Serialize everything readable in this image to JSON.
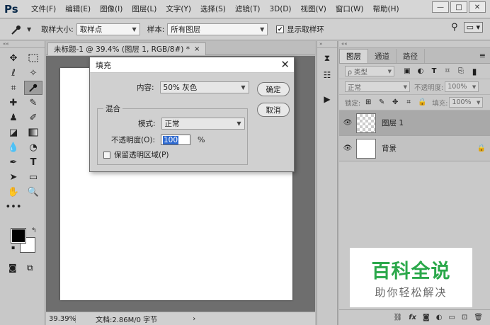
{
  "app": {
    "logo": "Ps",
    "menu": [
      "文件(F)",
      "编辑(E)",
      "图像(I)",
      "图层(L)",
      "文字(Y)",
      "选择(S)",
      "滤镜(T)",
      "3D(D)",
      "视图(V)",
      "窗口(W)",
      "帮助(H)"
    ],
    "window_controls": {
      "minimize": "—",
      "maximize": "□",
      "close": "✕"
    }
  },
  "options": {
    "sample_size_label": "取样大小:",
    "sample_size_value": "取样点",
    "sample_label": "样本:",
    "sample_value": "所有图层",
    "ring_checked": "✔",
    "ring_label": "显示取样环"
  },
  "document": {
    "tab_title": "未标题-1 @ 39.4% (图层 1, RGB/8#) *",
    "tab_close": "×",
    "zoom": "39.39%",
    "doc_info": "文档:2.86M/0 字节",
    "status_arrow": "›"
  },
  "layers_panel": {
    "tabs": [
      "图层",
      "通道",
      "路径"
    ],
    "filter_label": "ρ 类型",
    "blend_mode": "正常",
    "opacity_label": "不透明度:",
    "opacity_value": "100%",
    "lock_label": "锁定:",
    "fill_label": "填充:",
    "fill_value": "100%",
    "layers": [
      {
        "name": "图层 1"
      },
      {
        "name": "背景",
        "lock": "🔒"
      }
    ],
    "footer_fx": "fx"
  },
  "dialog": {
    "title": "填充",
    "close": "✕",
    "contents_label": "内容:",
    "contents_value": "50% 灰色",
    "ok": "确定",
    "cancel": "取消",
    "blend_legend": "混合",
    "mode_label": "模式:",
    "mode_value": "正常",
    "opacity_label": "不透明度(O):",
    "opacity_value": "100",
    "percent": "%",
    "preserve_label": "保留透明区域(P)"
  },
  "watermark": {
    "title": "百科全说",
    "subtitle": "助你轻松解决"
  }
}
